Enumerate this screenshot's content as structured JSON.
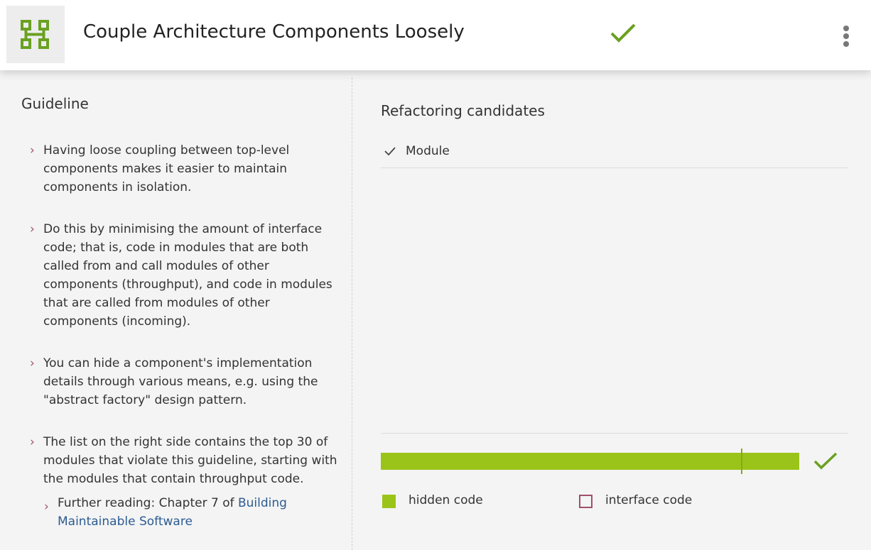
{
  "header": {
    "title": "Couple Architecture Components Loosely",
    "logo_icon": "components-icon",
    "status_icon": "check-icon",
    "menu_icon": "more-vertical-icon"
  },
  "guideline": {
    "title": "Guideline",
    "items": [
      "Having loose coupling between top-level components makes it easier to maintain components in isolation.",
      "Do this by minimising the amount of interface code; that is, code in modules that are both called from and call modules of other components (throughput), and code in modules that are called from modules of other components (incoming).",
      "You can hide a component's implementation details through various means, e.g. using the \"abstract factory\" design pattern.",
      "The list on the right side contains the top 30 of modules that violate this guideline, starting with the modules that contain throughput code."
    ],
    "further_prefix": "Further reading: Chapter 7 of ",
    "further_link": "Building Maintainable Software"
  },
  "refactoring": {
    "title": "Refactoring candidates",
    "column_header": "Module",
    "bar": {
      "hidden_fraction": 1.0,
      "marker_fraction": 0.861
    },
    "legend": {
      "hidden_label": "hidden code",
      "interface_label": "interface code"
    }
  },
  "colors": {
    "accent_green": "#9bc41a",
    "check_green": "#6aa121",
    "interface_red": "#a0506a",
    "link_blue": "#2d5b92"
  }
}
